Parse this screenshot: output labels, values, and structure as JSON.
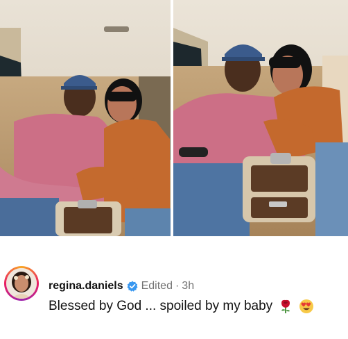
{
  "post": {
    "username": "regina.daniels",
    "edited_label": "Edited",
    "separator": "·",
    "time_ago": "3h",
    "caption": "Blessed by God ... spoiled by my baby",
    "caption_emojis": [
      "rose-icon",
      "heart-eyes-icon"
    ]
  },
  "photos": {
    "count": 2
  },
  "colors": {
    "verified_badge": "#3897f0",
    "secondary_text": "#737373",
    "primary_text": "#111111"
  }
}
